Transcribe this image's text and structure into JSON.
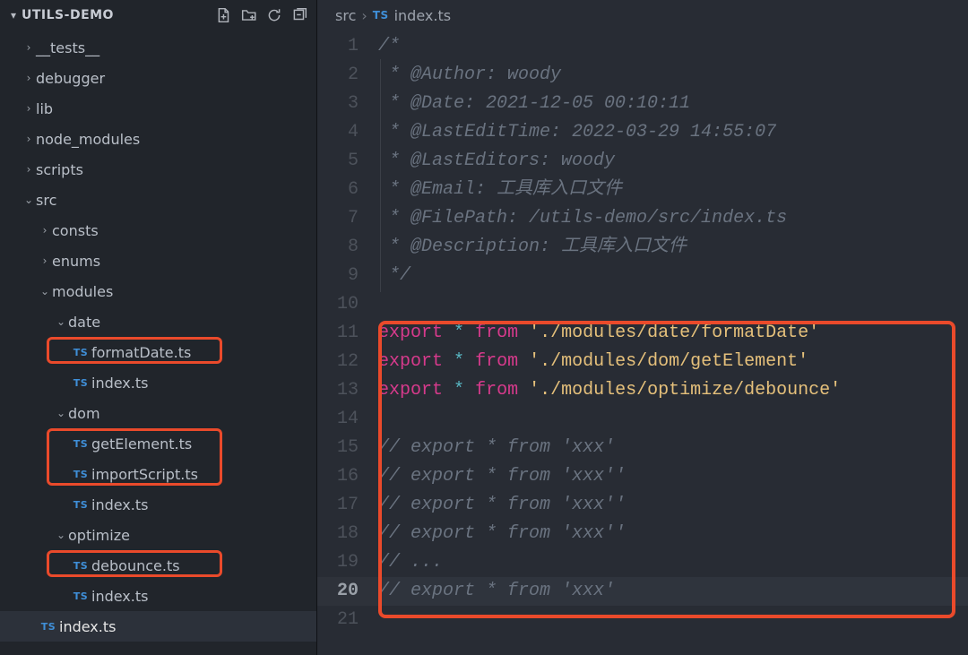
{
  "sidebar": {
    "title": "UTILS-DEMO",
    "action_icons": [
      "new-file-icon",
      "new-folder-icon",
      "refresh-icon",
      "collapse-all-icon"
    ],
    "tree": [
      {
        "depth": 0,
        "kind": "folder",
        "open": false,
        "label": "__tests__"
      },
      {
        "depth": 0,
        "kind": "folder",
        "open": false,
        "label": "debugger"
      },
      {
        "depth": 0,
        "kind": "folder",
        "open": false,
        "label": "lib"
      },
      {
        "depth": 0,
        "kind": "folder",
        "open": false,
        "label": "node_modules"
      },
      {
        "depth": 0,
        "kind": "folder",
        "open": false,
        "label": "scripts"
      },
      {
        "depth": 0,
        "kind": "folder",
        "open": true,
        "label": "src"
      },
      {
        "depth": 1,
        "kind": "folder",
        "open": false,
        "label": "consts"
      },
      {
        "depth": 1,
        "kind": "folder",
        "open": false,
        "label": "enums"
      },
      {
        "depth": 1,
        "kind": "folder",
        "open": true,
        "label": "modules"
      },
      {
        "depth": 2,
        "kind": "folder",
        "open": true,
        "label": "date"
      },
      {
        "depth": 3,
        "kind": "file-ts",
        "label": "formatDate.ts",
        "highlight": true
      },
      {
        "depth": 3,
        "kind": "file-ts",
        "label": "index.ts"
      },
      {
        "depth": 2,
        "kind": "folder",
        "open": true,
        "label": "dom"
      },
      {
        "depth": 3,
        "kind": "file-ts",
        "label": "getElement.ts",
        "highlight": "group-a"
      },
      {
        "depth": 3,
        "kind": "file-ts",
        "label": "importScript.ts",
        "highlight": "group-a"
      },
      {
        "depth": 3,
        "kind": "file-ts",
        "label": "index.ts"
      },
      {
        "depth": 2,
        "kind": "folder",
        "open": true,
        "label": "optimize"
      },
      {
        "depth": 3,
        "kind": "file-ts",
        "label": "debounce.ts",
        "highlight": true
      },
      {
        "depth": 3,
        "kind": "file-ts",
        "label": "index.ts"
      },
      {
        "depth": 1,
        "kind": "file-ts",
        "label": "index.ts",
        "selected": true
      }
    ]
  },
  "breadcrumb": {
    "seg1": "src",
    "seg2": "index.ts",
    "ts_badge": "TS"
  },
  "editor": {
    "ts_badge": "TS",
    "current_line": 20,
    "lines": [
      {
        "n": 1,
        "tokens": [
          [
            "cm",
            "/*"
          ]
        ]
      },
      {
        "n": 2,
        "tokens": [
          [
            "cm",
            " * @Author: woody"
          ]
        ]
      },
      {
        "n": 3,
        "tokens": [
          [
            "cm",
            " * @Date: 2021-12-05 00:10:11"
          ]
        ]
      },
      {
        "n": 4,
        "tokens": [
          [
            "cm",
            " * @LastEditTime: 2022-03-29 14:55:07"
          ]
        ]
      },
      {
        "n": 5,
        "tokens": [
          [
            "cm",
            " * @LastEditors: woody"
          ]
        ]
      },
      {
        "n": 6,
        "tokens": [
          [
            "cm",
            " * @Email: 工具库入口文件"
          ]
        ]
      },
      {
        "n": 7,
        "tokens": [
          [
            "cm",
            " * @FilePath: /utils-demo/src/index.ts"
          ]
        ]
      },
      {
        "n": 8,
        "tokens": [
          [
            "cm",
            " * @Description: 工具库入口文件"
          ]
        ]
      },
      {
        "n": 9,
        "tokens": [
          [
            "cm",
            " */"
          ]
        ]
      },
      {
        "n": 10,
        "tokens": []
      },
      {
        "n": 11,
        "tokens": [
          [
            "kw",
            "export"
          ],
          [
            "pl",
            " "
          ],
          [
            "op",
            "*"
          ],
          [
            "pl",
            " "
          ],
          [
            "kw",
            "from"
          ],
          [
            "pl",
            " "
          ],
          [
            "str",
            "'./modules/date/formatDate'"
          ]
        ]
      },
      {
        "n": 12,
        "tokens": [
          [
            "kw",
            "export"
          ],
          [
            "pl",
            " "
          ],
          [
            "op",
            "*"
          ],
          [
            "pl",
            " "
          ],
          [
            "kw",
            "from"
          ],
          [
            "pl",
            " "
          ],
          [
            "str",
            "'./modules/dom/getElement'"
          ]
        ]
      },
      {
        "n": 13,
        "tokens": [
          [
            "kw",
            "export"
          ],
          [
            "pl",
            " "
          ],
          [
            "op",
            "*"
          ],
          [
            "pl",
            " "
          ],
          [
            "kw",
            "from"
          ],
          [
            "pl",
            " "
          ],
          [
            "str",
            "'./modules/optimize/debounce'"
          ]
        ]
      },
      {
        "n": 14,
        "tokens": []
      },
      {
        "n": 15,
        "tokens": [
          [
            "cm",
            "// export * from 'xxx'"
          ]
        ]
      },
      {
        "n": 16,
        "tokens": [
          [
            "cm",
            "// export * from 'xxx''"
          ]
        ]
      },
      {
        "n": 17,
        "tokens": [
          [
            "cm",
            "// export * from 'xxx''"
          ]
        ]
      },
      {
        "n": 18,
        "tokens": [
          [
            "cm",
            "// export * from 'xxx''"
          ]
        ]
      },
      {
        "n": 19,
        "tokens": [
          [
            "cm",
            "// ..."
          ]
        ]
      },
      {
        "n": 20,
        "tokens": [
          [
            "cm",
            "// export * from 'xxx'"
          ]
        ]
      },
      {
        "n": 21,
        "tokens": []
      }
    ]
  }
}
